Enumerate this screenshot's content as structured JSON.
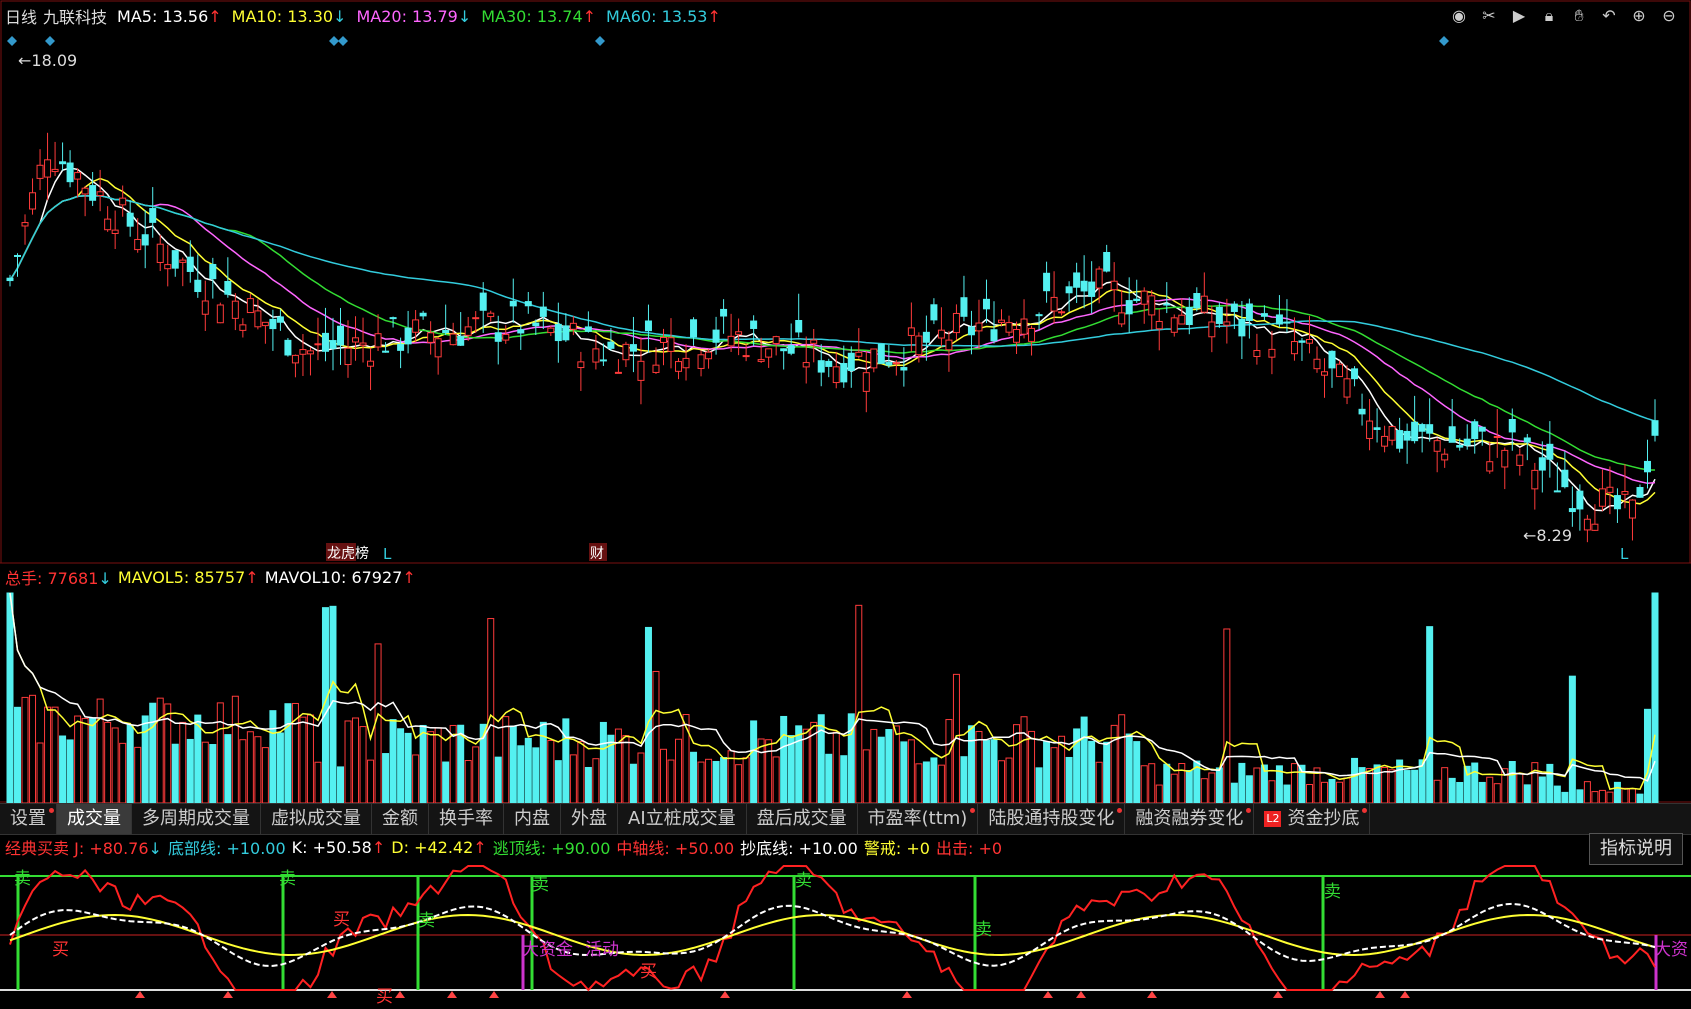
{
  "header": {
    "period": "日线",
    "stock": "九联科技",
    "ma": [
      {
        "label": "MA5:",
        "value": "13.56",
        "arrow": "↑",
        "color": "#ffffff"
      },
      {
        "label": "MA10:",
        "value": "13.30",
        "arrow": "↓",
        "color": "#ffff33"
      },
      {
        "label": "MA20:",
        "value": "13.79",
        "arrow": "↓",
        "color": "#ff66ff"
      },
      {
        "label": "MA30:",
        "value": "13.74",
        "arrow": "↑",
        "color": "#33dd33"
      },
      {
        "label": "MA60:",
        "value": "13.53",
        "arrow": "↑",
        "color": "#33ccdd"
      }
    ]
  },
  "toolbar_icons": [
    "eye-icon",
    "scissors-icon",
    "play-icon",
    "lock-icon",
    "hand-icon",
    "undo-icon",
    "zoom-in-icon",
    "zoom-out-icon"
  ],
  "price": {
    "high_label": "18.09",
    "low_label": "8.29",
    "marks": {
      "m1": "L",
      "m2": "L",
      "m3": "L",
      "tag1": "龙虎榜",
      "tag2": "财"
    }
  },
  "volume": {
    "title": "总手:",
    "value": "77681",
    "arrow": "↓",
    "mavol5_label": "MAVOL5:",
    "mavol5": "85757",
    "mavol5_arrow": "↑",
    "mavol10_label": "MAVOL10:",
    "mavol10": "67927",
    "mavol10_arrow": "↑"
  },
  "tabs": [
    {
      "label": "设置",
      "dot": true
    },
    {
      "label": "成交量",
      "active": true
    },
    {
      "label": "多周期成交量"
    },
    {
      "label": "虚拟成交量"
    },
    {
      "label": "金额"
    },
    {
      "label": "换手率"
    },
    {
      "label": "内盘"
    },
    {
      "label": "外盘"
    },
    {
      "label": "AI立桩成交量"
    },
    {
      "label": "盘后成交量"
    },
    {
      "label": "市盈率(ttm)",
      "dot": true
    },
    {
      "label": "陆股通持股变化",
      "dot": true
    },
    {
      "label": "融资融券变化",
      "dot": true
    },
    {
      "label": "资金抄底",
      "l2": "L2",
      "dot": true
    }
  ],
  "indicator": {
    "name": "经典买卖",
    "j_label": "J:",
    "j": "+80.76",
    "j_arrow": "↓",
    "bottom_label": "底部线:",
    "bottom": "+10.00",
    "k_label": "K:",
    "k": "+50.58",
    "k_arrow": "↑",
    "d_label": "D:",
    "d": "+42.42",
    "d_arrow": "↑",
    "top_label": "逃顶线:",
    "top": "+90.00",
    "mid_label": "中轴线:",
    "mid": "+50.00",
    "buy_label": "抄底线:",
    "buy": "+10.00",
    "warn_label": "警戒:",
    "warn": "+0",
    "out_label": "出击:",
    "out": "+0",
    "explain": "指标说明",
    "sell": "卖",
    "buyw": "买",
    "big_money": "大资金",
    "active": "活动",
    "big_money2": "大资"
  }
}
